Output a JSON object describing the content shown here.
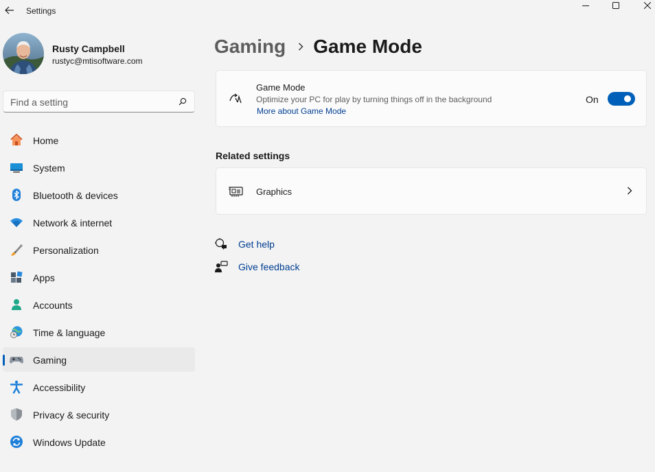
{
  "window": {
    "title": "Settings"
  },
  "user": {
    "name": "Rusty Campbell",
    "email": "rustyc@mtisoftware.com"
  },
  "search": {
    "placeholder": "Find a setting"
  },
  "nav": {
    "items": [
      {
        "label": "Home",
        "icon": "home-icon"
      },
      {
        "label": "System",
        "icon": "system-icon"
      },
      {
        "label": "Bluetooth & devices",
        "icon": "bluetooth-icon"
      },
      {
        "label": "Network & internet",
        "icon": "wifi-icon"
      },
      {
        "label": "Personalization",
        "icon": "brush-icon"
      },
      {
        "label": "Apps",
        "icon": "apps-icon"
      },
      {
        "label": "Accounts",
        "icon": "accounts-icon"
      },
      {
        "label": "Time & language",
        "icon": "globe-clock-icon"
      },
      {
        "label": "Gaming",
        "icon": "gamepad-icon",
        "active": true
      },
      {
        "label": "Accessibility",
        "icon": "accessibility-icon"
      },
      {
        "label": "Privacy & security",
        "icon": "shield-icon"
      },
      {
        "label": "Windows Update",
        "icon": "update-icon"
      }
    ]
  },
  "breadcrumb": {
    "parent": "Gaming",
    "current": "Game Mode"
  },
  "game_mode": {
    "title": "Game Mode",
    "description": "Optimize your PC for play by turning things off in the background",
    "link": "More about Game Mode",
    "state_label": "On",
    "enabled": true
  },
  "related": {
    "title": "Related settings",
    "graphics_label": "Graphics"
  },
  "help": {
    "get_help": "Get help",
    "give_feedback": "Give feedback"
  },
  "colors": {
    "accent": "#005fb8",
    "link": "#003e92",
    "background": "#f3f3f3",
    "card": "#fbfbfb"
  }
}
